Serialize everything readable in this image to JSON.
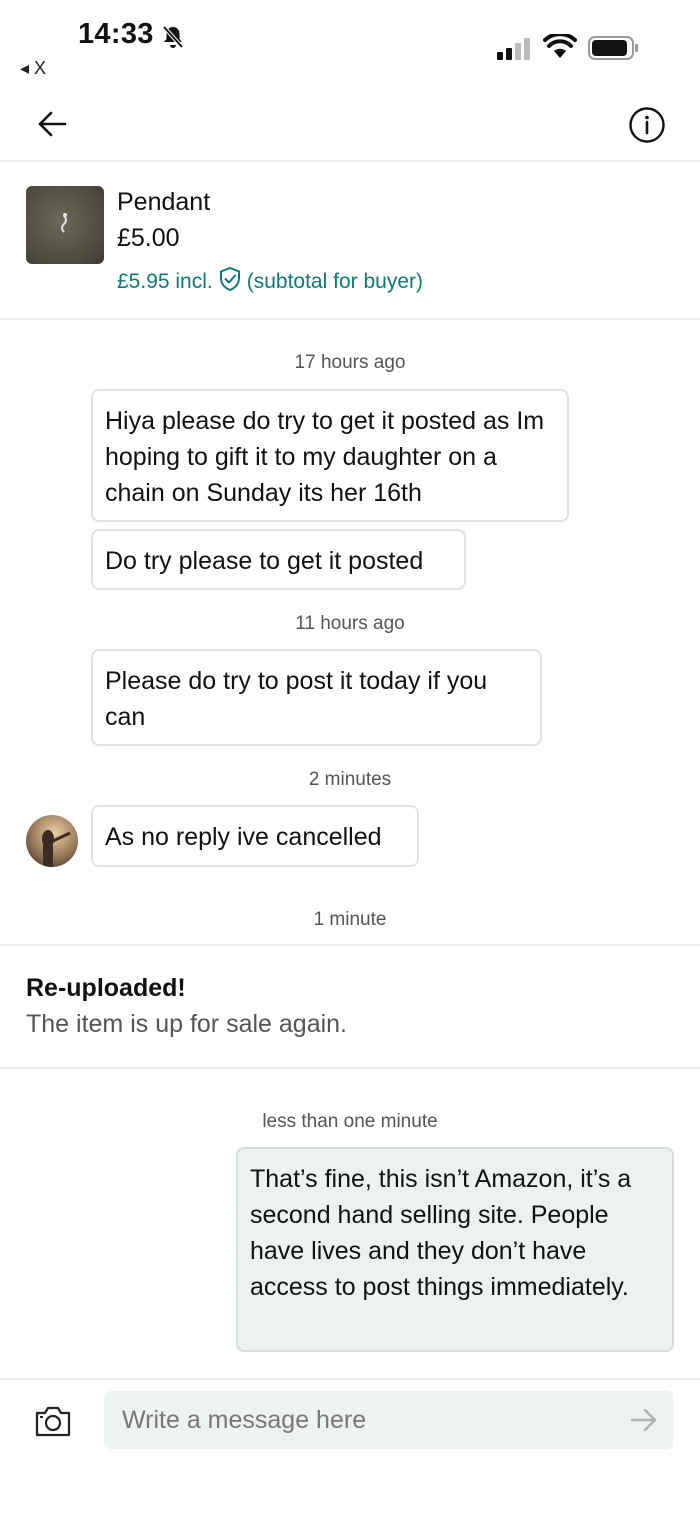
{
  "status_bar": {
    "time": "14:33",
    "back_app": "◂ X"
  },
  "header": {
    "title": ""
  },
  "item": {
    "name": "Pendant",
    "price": "£5.00",
    "incl_price": "£5.95 incl.",
    "incl_note": "(subtotal for buyer)"
  },
  "messages": {
    "ts1": "17 hours ago",
    "m1": "Hiya please do try to get it posted as Im hoping to gift it to my daughter on a chain on Sunday its her 16th",
    "m2": "Do try please to get it posted",
    "ts2": "11 hours ago",
    "m3": "Please do try to post it today if you can",
    "ts3": "2 minutes",
    "m4": "As no reply ive cancelled",
    "ts4": "1 minute",
    "reupload_title": "Re-uploaded!",
    "reupload_text": "The item is up for sale again.",
    "ts5": "less than one minute",
    "m5": "That’s fine, this isn’t Amazon, it’s a second hand selling site. People have lives and they don’t have access to post things immediately."
  },
  "composer": {
    "placeholder": "Write a message here"
  },
  "colors": {
    "accent": "#0d7a74",
    "own_bubble": "#ebf2f1",
    "input_bg": "#eef2f2"
  }
}
